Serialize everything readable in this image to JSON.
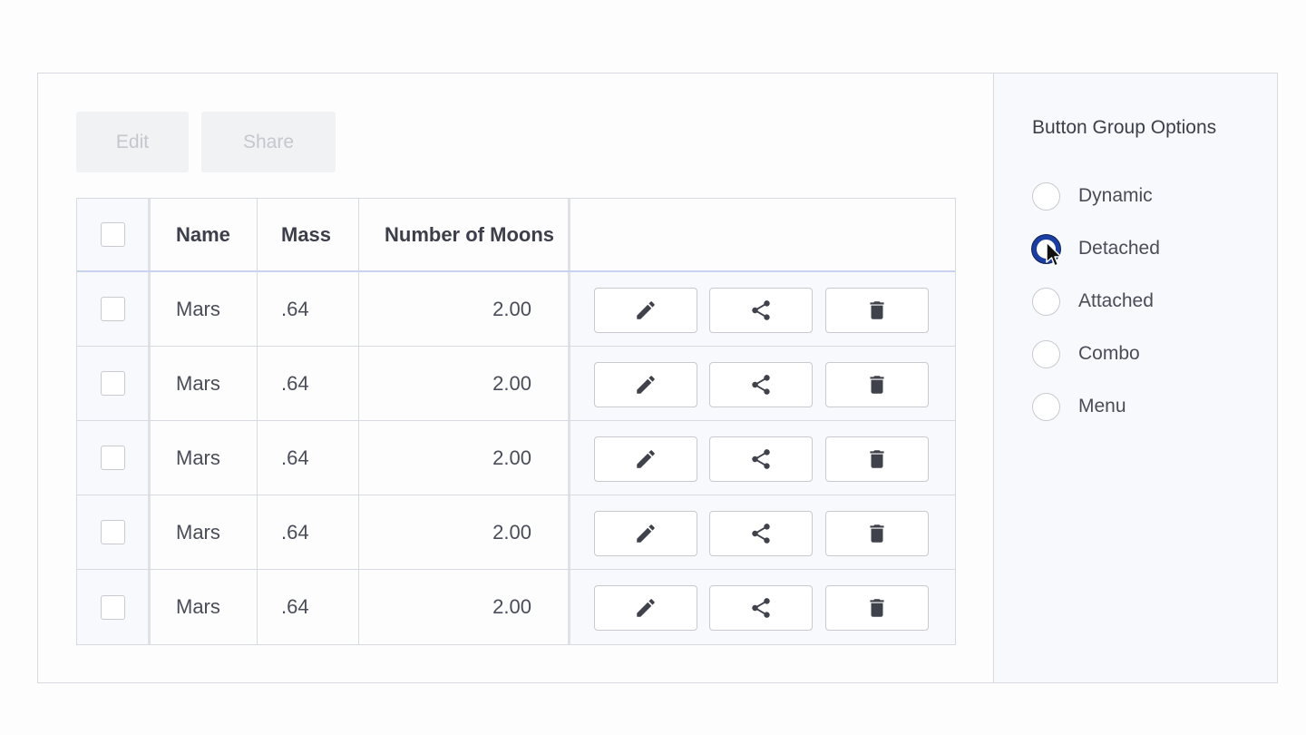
{
  "toolbar": {
    "edit_label": "Edit",
    "share_label": "Share"
  },
  "table": {
    "headers": {
      "name": "Name",
      "mass": "Mass",
      "moons": "Number of Moons"
    },
    "rows": [
      {
        "name": "Mars",
        "mass": ".64",
        "moons": "2.00"
      },
      {
        "name": "Mars",
        "mass": ".64",
        "moons": "2.00"
      },
      {
        "name": "Mars",
        "mass": ".64",
        "moons": "2.00"
      },
      {
        "name": "Mars",
        "mass": ".64",
        "moons": "2.00"
      },
      {
        "name": "Mars",
        "mass": ".64",
        "moons": "2.00"
      }
    ],
    "row_actions": [
      "pencil-icon",
      "share-icon",
      "trash-icon"
    ]
  },
  "sidebar": {
    "title": "Button Group Options",
    "options": [
      {
        "label": "Dynamic",
        "selected": false
      },
      {
        "label": "Detached",
        "selected": true
      },
      {
        "label": "Attached",
        "selected": false
      },
      {
        "label": "Combo",
        "selected": false
      },
      {
        "label": "Menu",
        "selected": false
      }
    ]
  },
  "colors": {
    "accent": "#1b3fa0",
    "border": "#d8dae1",
    "disabled_text": "#c4c7cd"
  }
}
